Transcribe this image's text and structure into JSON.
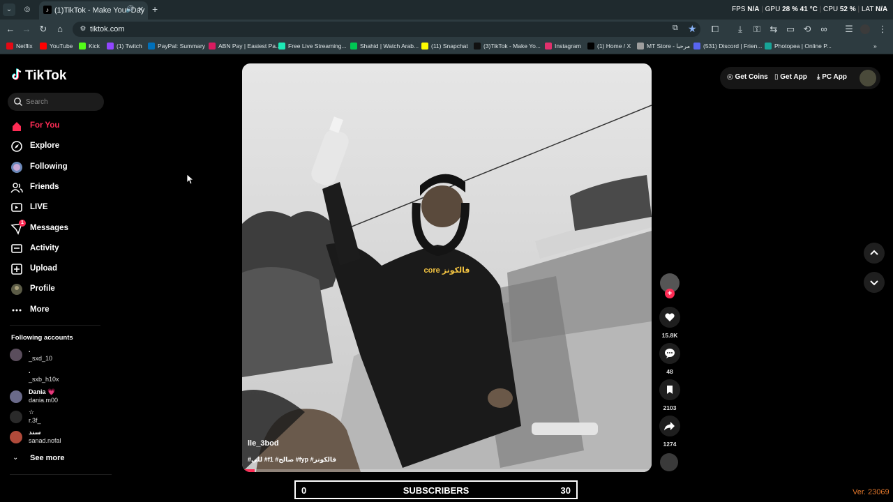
{
  "browser": {
    "tab_title": "(1)TikTok - Make Your Day",
    "url": "tiktok.com",
    "perf": {
      "fps_label": "FPS",
      "fps_value": "N/A",
      "gpu_label": "GPU",
      "gpu_value": "28 %",
      "gpu_temp": "41 °C",
      "cpu_label": "CPU",
      "cpu_value": "52 %",
      "lat_label": "LAT",
      "lat_value": "N/A"
    },
    "bookmarks": [
      {
        "label": "Netflix",
        "color": "#e50914"
      },
      {
        "label": "YouTube",
        "color": "#ff0000"
      },
      {
        "label": "Kick",
        "color": "#53fc18"
      },
      {
        "label": "(1) Twitch",
        "color": "#9146ff"
      },
      {
        "label": "PayPal: Summary",
        "color": "#0070ba"
      },
      {
        "label": "ABN Pay | Easiest Pa...",
        "color": "#d81b60"
      },
      {
        "label": "Free Live Streaming...",
        "color": "#1de9b6"
      },
      {
        "label": "Shahid | Watch Arab...",
        "color": "#00c853"
      },
      {
        "label": "(11) Snapchat",
        "color": "#fffc00"
      },
      {
        "label": "(3)TikTok - Make Yo...",
        "color": "#111111"
      },
      {
        "label": "Instagram",
        "color": "#e1306c"
      },
      {
        "label": "(1) Home / X",
        "color": "#000000"
      },
      {
        "label": "MT Store - مرحبا",
        "color": "#9e9e9e"
      },
      {
        "label": "(531) Discord | Frien...",
        "color": "#5865f2"
      },
      {
        "label": "Photopea | Online P...",
        "color": "#18a497"
      }
    ]
  },
  "tiktok": {
    "logo": "TikTok",
    "search_placeholder": "Search",
    "nav": [
      {
        "label": "For You",
        "icon": "home-icon",
        "active": true
      },
      {
        "label": "Explore",
        "icon": "compass-icon"
      },
      {
        "label": "Following",
        "icon": "following-avatar-icon"
      },
      {
        "label": "Friends",
        "icon": "friends-icon"
      },
      {
        "label": "LIVE",
        "icon": "live-icon"
      },
      {
        "label": "Messages",
        "icon": "messages-icon",
        "badge": "1"
      },
      {
        "label": "Activity",
        "icon": "activity-icon"
      },
      {
        "label": "Upload",
        "icon": "upload-icon"
      },
      {
        "label": "Profile",
        "icon": "profile-icon"
      },
      {
        "label": "More",
        "icon": "more-icon"
      }
    ],
    "following_title": "Following accounts",
    "following": [
      {
        "name": ".",
        "handle": "_sxd_10"
      },
      {
        "name": ".",
        "handle": "_sxb_h10x"
      },
      {
        "name": "Dania 💗",
        "handle": "dania.m00"
      },
      {
        "name": "☆",
        "handle": "r.3f_"
      },
      {
        "name": "سند",
        "handle": "sanad.nofal"
      }
    ],
    "see_more": "See more",
    "video": {
      "caption_overlay": "core قالكونز",
      "author": "lle_3bod",
      "tags": "#للي #f1 #صالح #fyp #قالكونز",
      "progress": 0.03
    },
    "actions": {
      "likes": "15.8K",
      "comments": "48",
      "saves": "2103",
      "shares": "1274"
    },
    "top_right": {
      "get_coins": "Get Coins",
      "get_app": "Get App",
      "pc_app": "PC App"
    }
  },
  "overlay": {
    "subs_current": "0",
    "subs_label": "SUBSCRIBERS",
    "subs_goal": "30",
    "version": "Ver. 23069"
  },
  "colors": {
    "accent": "#fe2c55",
    "chrome_bg": "#2d3b40",
    "version": "#e0762b"
  }
}
